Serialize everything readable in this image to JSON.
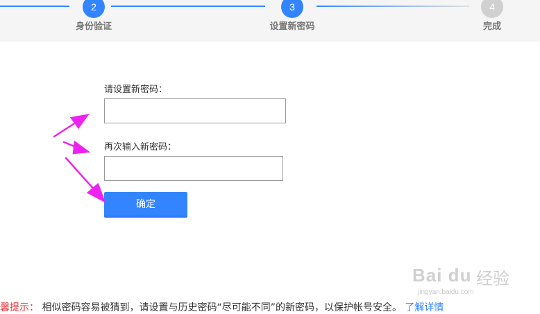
{
  "stepper": {
    "steps": [
      {
        "number": "2",
        "label": "身份验证"
      },
      {
        "number": "3",
        "label": "设置新密码"
      },
      {
        "number": "4",
        "label": "完成"
      }
    ],
    "accent_color": "#3385ff",
    "inactive_color": "#d0d0d0"
  },
  "form": {
    "new_password_label": "请设置新密码：",
    "new_password_value": "",
    "confirm_password_label": "再次输入新密码：",
    "confirm_password_value": "",
    "submit_label": "确定"
  },
  "tip": {
    "prefix": "温馨提示：",
    "message": "相似密码容易被猜到，请设置与历史密码“尽可能不同”的新密码，以保护帐号安全。",
    "link_label": "了解详情"
  },
  "watermark": {
    "logo_text": "Bai du",
    "brand_text": "经验",
    "url": "jingyan.baidu.com"
  },
  "annotation_color": "#ee22ee"
}
